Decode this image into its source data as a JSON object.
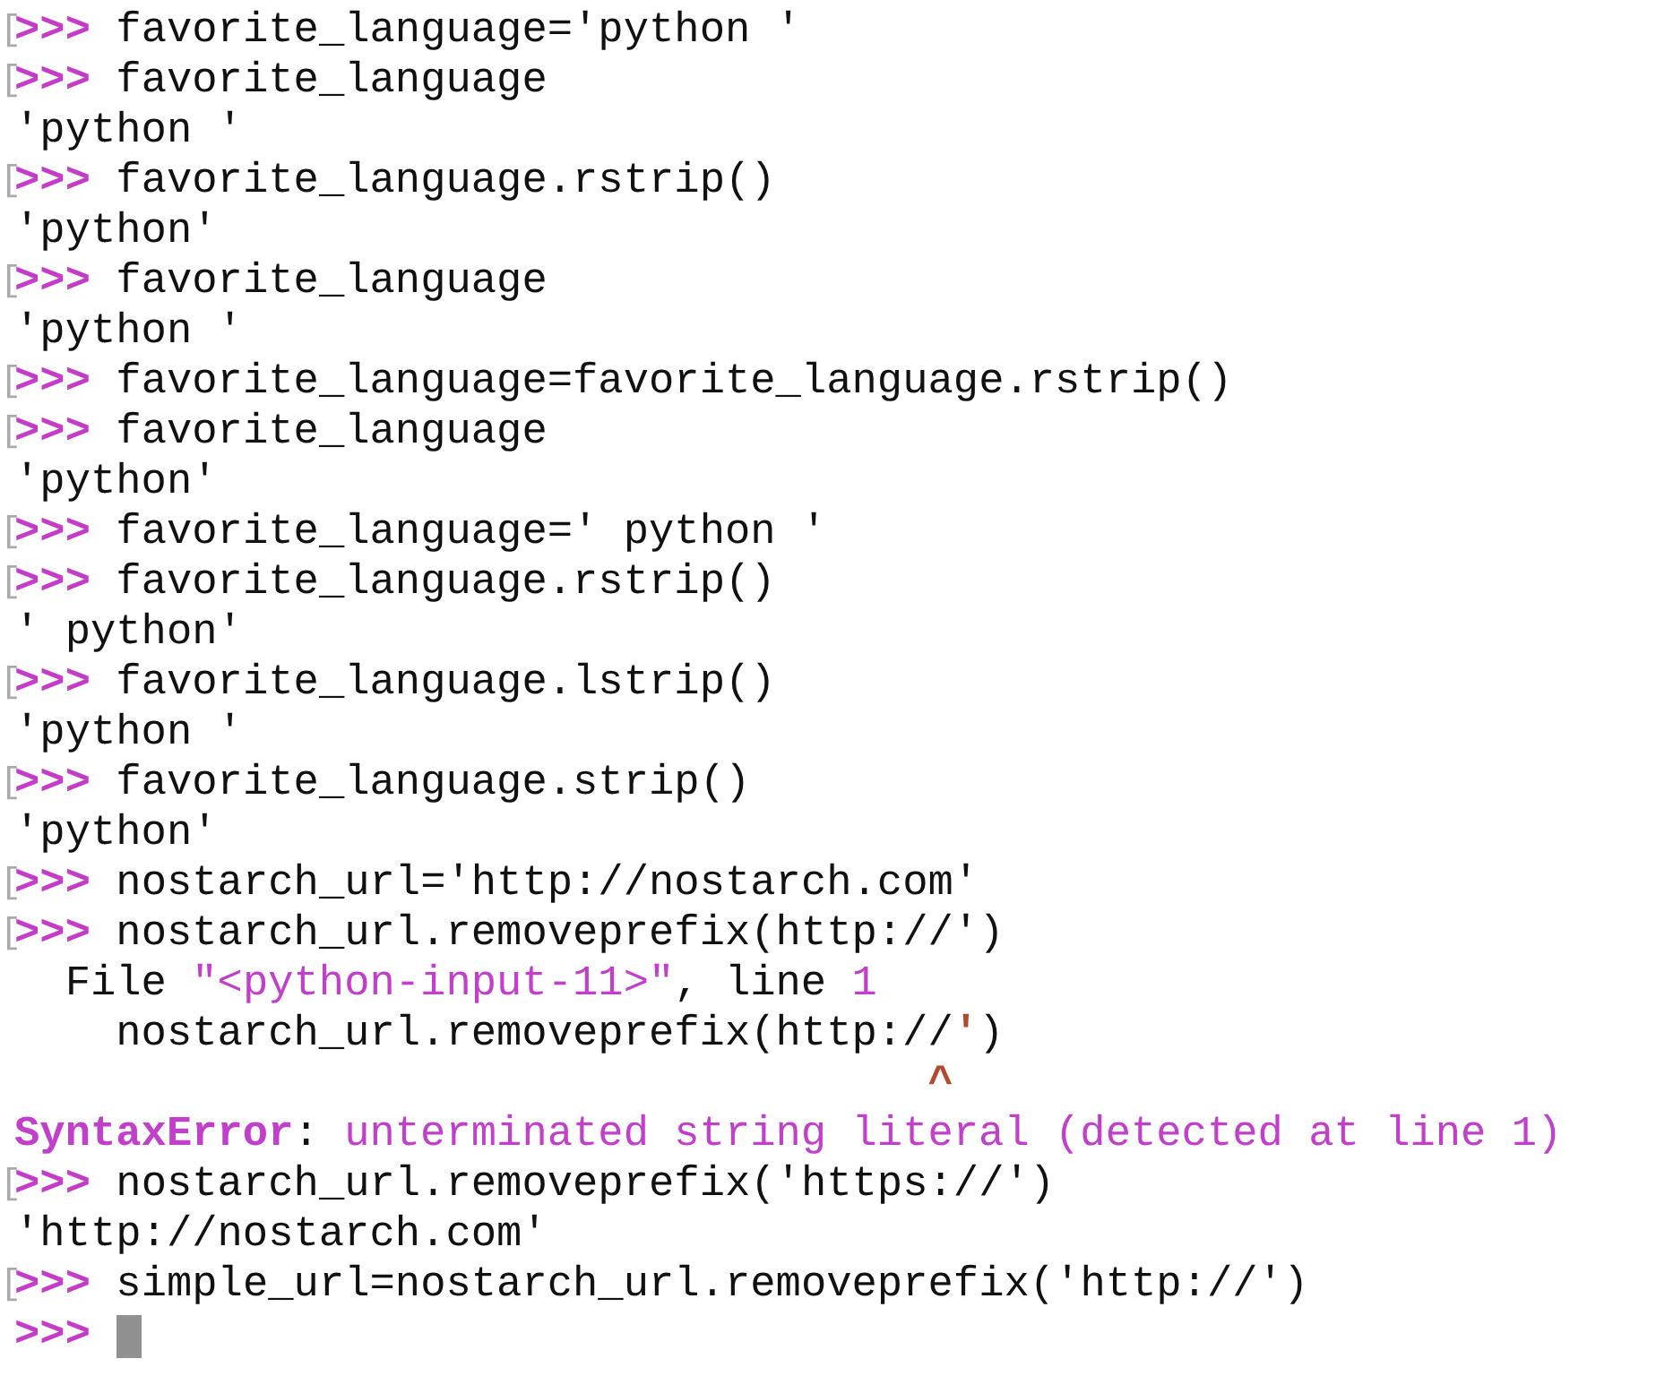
{
  "lines": [
    {
      "kind": "input",
      "marker": "[",
      "prompt": ">>>",
      "code": "favorite_language='python '"
    },
    {
      "kind": "input",
      "marker": "[",
      "prompt": ">>>",
      "code": "favorite_language"
    },
    {
      "kind": "output",
      "segments": [
        {
          "kind": "plain",
          "text": "'python '"
        }
      ]
    },
    {
      "kind": "input",
      "marker": "[",
      "prompt": ">>>",
      "code": "favorite_language.rstrip()"
    },
    {
      "kind": "output",
      "segments": [
        {
          "kind": "plain",
          "text": "'python'"
        }
      ]
    },
    {
      "kind": "input",
      "marker": "[",
      "prompt": ">>>",
      "code": "favorite_language"
    },
    {
      "kind": "output",
      "segments": [
        {
          "kind": "plain",
          "text": "'python '"
        }
      ]
    },
    {
      "kind": "input",
      "marker": "[",
      "prompt": ">>>",
      "code": "favorite_language=favorite_language.rstrip()"
    },
    {
      "kind": "input",
      "marker": "[",
      "prompt": ">>>",
      "code": "favorite_language"
    },
    {
      "kind": "output",
      "segments": [
        {
          "kind": "plain",
          "text": "'python'"
        }
      ]
    },
    {
      "kind": "input",
      "marker": "[",
      "prompt": ">>>",
      "code": "favorite_language=' python '"
    },
    {
      "kind": "input",
      "marker": "[",
      "prompt": ">>>",
      "code": "favorite_language.rstrip()"
    },
    {
      "kind": "output",
      "segments": [
        {
          "kind": "plain",
          "text": "' python'"
        }
      ]
    },
    {
      "kind": "input",
      "marker": "[",
      "prompt": ">>>",
      "code": "favorite_language.lstrip()"
    },
    {
      "kind": "output",
      "segments": [
        {
          "kind": "plain",
          "text": "'python '"
        }
      ]
    },
    {
      "kind": "input",
      "marker": "[",
      "prompt": ">>>",
      "code": "favorite_language.strip()"
    },
    {
      "kind": "output",
      "segments": [
        {
          "kind": "plain",
          "text": "'python'"
        }
      ]
    },
    {
      "kind": "input",
      "marker": "[",
      "prompt": ">>>",
      "code": "nostarch_url='http://nostarch.com'"
    },
    {
      "kind": "input",
      "marker": "[",
      "prompt": ">>>",
      "code": "nostarch_url.removeprefix(http://')"
    },
    {
      "kind": "output",
      "segments": [
        {
          "kind": "plain",
          "text": "  File "
        },
        {
          "kind": "accent",
          "text": "\"<python-input-11>\""
        },
        {
          "kind": "plain",
          "text": ", line "
        },
        {
          "kind": "accent",
          "text": "1"
        }
      ]
    },
    {
      "kind": "output",
      "segments": [
        {
          "kind": "plain",
          "text": "    nostarch_url.removeprefix(http://"
        },
        {
          "kind": "marked",
          "text": "'"
        },
        {
          "kind": "plain",
          "text": ")"
        }
      ]
    },
    {
      "kind": "caret",
      "text": "^"
    },
    {
      "kind": "output",
      "segments": [
        {
          "kind": "error",
          "text": "SyntaxError"
        },
        {
          "kind": "plain",
          "text": ": "
        },
        {
          "kind": "accent",
          "text": "unterminated string literal (detected at line 1)"
        }
      ]
    },
    {
      "kind": "input",
      "marker": "[",
      "prompt": ">>>",
      "code": "nostarch_url.removeprefix('https://')"
    },
    {
      "kind": "output",
      "segments": [
        {
          "kind": "plain",
          "text": "'http://nostarch.com'"
        }
      ]
    },
    {
      "kind": "input",
      "marker": "[",
      "prompt": ">>>",
      "code": "simple_url=nostarch_url.removeprefix('http://')"
    },
    {
      "kind": "cursor",
      "prompt": ">>>"
    }
  ]
}
